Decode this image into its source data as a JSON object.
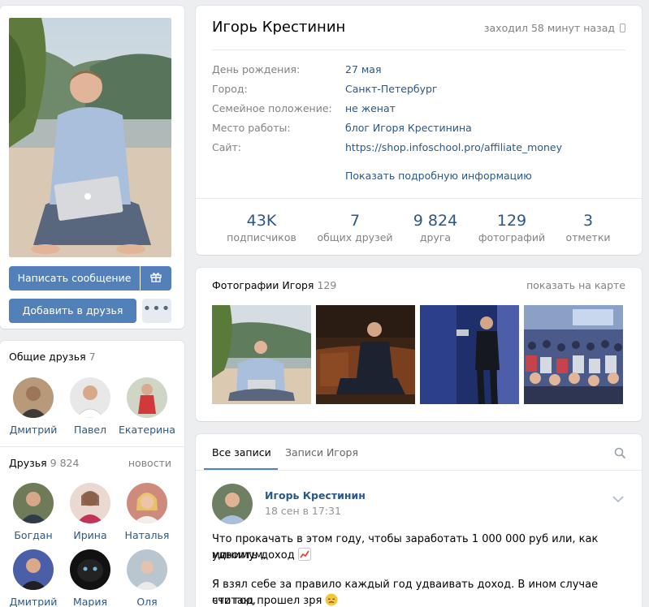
{
  "profile": {
    "name": "Игорь Крестинин",
    "last_seen": "заходил 58 минут назад"
  },
  "actions": {
    "message": "Написать сообщение",
    "add_friend": "Добавить в друзья",
    "more": "•••"
  },
  "info": {
    "rows": [
      {
        "label": "День рождения:",
        "value": "27 мая"
      },
      {
        "label": "Город:",
        "value": "Санкт-Петербург"
      },
      {
        "label": "Семейное положение:",
        "value": "не женат"
      },
      {
        "label": "Место работы:",
        "value": "блог Игоря Крестинина"
      },
      {
        "label": "Сайт:",
        "value": "https://shop.infoschool.pro/affiliate_money"
      }
    ],
    "show_more": "Показать подробную информацию"
  },
  "stats": [
    {
      "value": "43K",
      "label": "подписчиков"
    },
    {
      "value": "7",
      "label": "общих друзей"
    },
    {
      "value": "9 824",
      "label": "друга"
    },
    {
      "value": "129",
      "label": "фотографий"
    },
    {
      "value": "3",
      "label": "отметки"
    }
  ],
  "photos": {
    "title": "Фотографии Игоря",
    "count": "129",
    "map_link": "показать на карте"
  },
  "mutual_friends": {
    "title": "Общие друзья",
    "count": "7",
    "items": [
      {
        "name": "Дмитрий"
      },
      {
        "name": "Павел"
      },
      {
        "name": "Екатерина"
      }
    ]
  },
  "friends": {
    "title": "Друзья",
    "count": "9 824",
    "link": "новости",
    "items": [
      {
        "name": "Богдан"
      },
      {
        "name": "Ирина"
      },
      {
        "name": "Наталья"
      },
      {
        "name": "Дмитрий"
      },
      {
        "name": "Мария"
      },
      {
        "name": "Оля"
      }
    ]
  },
  "wall": {
    "tab_all": "Все записи",
    "tab_own": "Записи Игоря",
    "post": {
      "author": "Игорь Крестинин",
      "date": "18 сен в 17:31",
      "line1": "Что прокачать в этом году, чтобы заработать 1 000 000 руб или, как минимум,",
      "line2": "удвоить доход",
      "line3": "Я взял себе за правило каждый год удваивать доход. В ином случае считаю,",
      "line4": "что год прошел зря"
    }
  },
  "colors": {
    "accent": "#5181b8",
    "link": "#2a5885",
    "muted": "#828282",
    "background": "#edeef0"
  }
}
